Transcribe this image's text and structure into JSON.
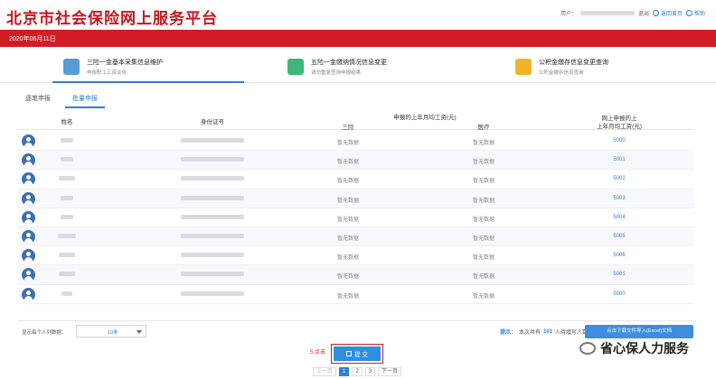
{
  "header": {
    "site_title": "北京市社会保险网上服务平台",
    "user_prefix": "用户：",
    "exit_label": "退出",
    "link1_label": "返回首页",
    "link2_label": "帮助"
  },
  "redbar": {
    "date": "2020年06月11日"
  },
  "services": [
    {
      "title": "三险一金基本采集信息维护",
      "sub": "申报职工工资业务",
      "icon_color": "#5b9bd5"
    },
    {
      "title": "五险一金缴纳情况信息变更",
      "sub": "请勿重复查询申报结果",
      "icon_color": "#3eb67a"
    },
    {
      "title": "公积金缴存信息变更查询",
      "sub": "公积金缴存信息查询",
      "icon_color": "#f0b429"
    }
  ],
  "tabs": [
    {
      "label": "逐笔申报",
      "active": false
    },
    {
      "label": "批量申报",
      "active": true
    }
  ],
  "table": {
    "col_name": "姓名",
    "col_id": "身份证号",
    "col_group": "申报的上年月均工资(元)",
    "col_a": "三险",
    "col_b": "医疗",
    "col_v_line1": "网上申报的上",
    "col_v_line2": "上年月均工资(元)",
    "no_data": "暂无数据",
    "rows": [
      {
        "value": "5000"
      },
      {
        "value": "5001"
      },
      {
        "value": "5002"
      },
      {
        "value": "5003"
      },
      {
        "value": "5004"
      },
      {
        "value": "5005"
      },
      {
        "value": "5006"
      },
      {
        "value": "5001"
      },
      {
        "value": "5000"
      }
    ]
  },
  "bottom_bar": {
    "page_size_label": "显示每个人列数据：",
    "page_size_value": "10条",
    "tip_label": "提示：",
    "tip_text_a": "本次共有",
    "tip_count": "101",
    "tip_text_b": "人待填写人数",
    "excel_button": "点击下载文件导入(Excel)文档"
  },
  "submit": {
    "note": "5.点击",
    "label": "提 交"
  },
  "pager": {
    "prev": "上一页",
    "pages": [
      "1",
      "2",
      "3"
    ],
    "active": "1",
    "next": "下一页"
  },
  "watermark": {
    "text": "省心保人力服务"
  }
}
